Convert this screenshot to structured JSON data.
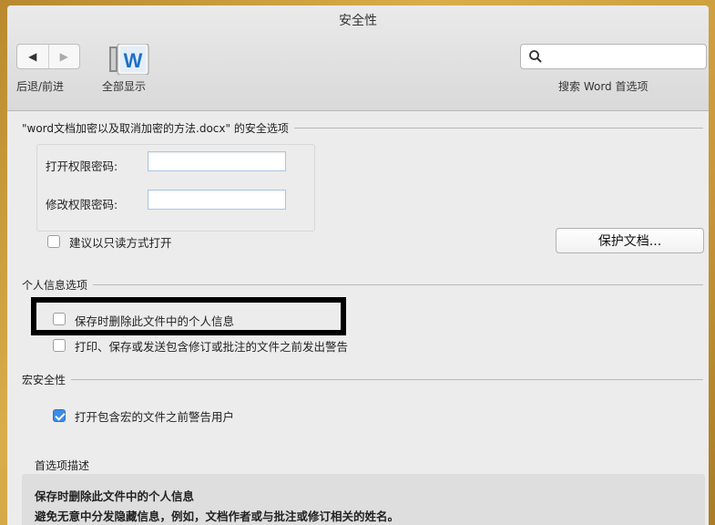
{
  "window": {
    "title": "安全性"
  },
  "toolbar": {
    "back_glyph": "◀",
    "forward_glyph": "▶",
    "nav_label": "后退/前进",
    "show_all_label": "全部显示",
    "word_letter": "W",
    "search_placeholder": "",
    "search_label": "搜索 Word 首选项"
  },
  "document_security": {
    "heading": "\"word文档加密以及取消加密的方法.docx\" 的安全选项",
    "open_password_label": "打开权限密码:",
    "open_password_value": "",
    "modify_password_label": "修改权限密码:",
    "modify_password_value": "",
    "read_only_label": "建议以只读方式打开",
    "read_only_checked": false,
    "protect_button_label": "保护文档..."
  },
  "privacy": {
    "heading": "个人信息选项",
    "remove_info_label": "保存时删除此文件中的个人信息",
    "remove_info_checked": false,
    "warn_label": "打印、保存或发送包含修订或批注的文件之前发出警告",
    "warn_checked": false
  },
  "macro": {
    "heading": "宏安全性",
    "warn_macro_label": "打开包含宏的文件之前警告用户",
    "warn_macro_checked": true
  },
  "description": {
    "heading": "首选项描述",
    "title": "保存时删除此文件中的个人信息",
    "text": "避免无意中分发隐藏信息，例如，文档作者或与批注或修订相关的姓名。"
  },
  "colors": {
    "accent": "#3b8be8",
    "background_frame": "#c99a3a",
    "highlight": "#000000"
  }
}
